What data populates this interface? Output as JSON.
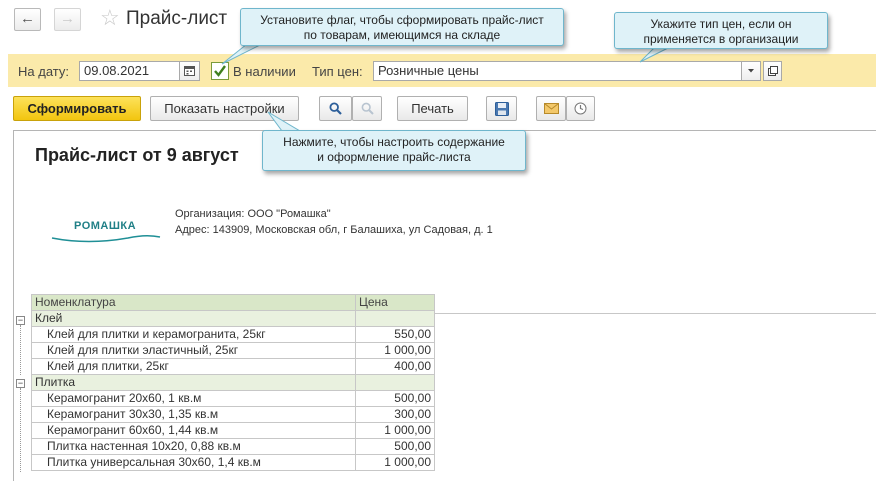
{
  "window": {
    "title": "Прайс-лист"
  },
  "icons": {
    "back": "arrow-left-icon",
    "forward": "arrow-right-icon",
    "favorite": "star-icon",
    "calendar": "calendar-icon",
    "checkbox": "checkmark-icon",
    "dropdown": "chevron-down-icon",
    "open": "open-form-icon",
    "search": "search-icon",
    "cancel_search": "cancel-search-icon",
    "save": "floppy-disk-icon",
    "email": "envelope-icon",
    "schedule": "clock-icon"
  },
  "params": {
    "date_label": "На дату:",
    "date_value": "09.08.2021",
    "in_stock_label": "В наличии",
    "in_stock_checked": true,
    "price_type_label": "Тип цен:",
    "price_type_value": "Розничные цены"
  },
  "toolbar": {
    "generate": "Сформировать",
    "show_settings": "Показать настройки",
    "print": "Печать"
  },
  "callouts": {
    "in_stock": [
      "Установите флаг, чтобы сформировать прайс-лист",
      "по товарам, имеющимся на складе"
    ],
    "price_type": [
      "Укажите тип цен, если он",
      "применяется в организации"
    ],
    "settings": [
      "Нажмите, чтобы настроить содержание",
      "и оформление прайс-листа"
    ]
  },
  "report": {
    "title": "Прайс-лист от 9 август",
    "logo_text": "РОМАШКА",
    "organization": "Организация: ООО \"Ромашка\"",
    "address": "Адрес: 143909, Московская обл, г Балашиха, ул Садовая, д. 1",
    "columns": [
      "Номенклатура",
      "Цена"
    ],
    "groups": [
      {
        "name": "Клей",
        "items": [
          {
            "name": "Клей для плитки и керамогранита, 25кг",
            "price": "550,00"
          },
          {
            "name": "Клей для плитки эластичный, 25кг",
            "price": "1 000,00"
          },
          {
            "name": "Клей для плитки, 25кг",
            "price": "400,00"
          }
        ]
      },
      {
        "name": "Плитка",
        "items": [
          {
            "name": "Керамогранит 20х60, 1 кв.м",
            "price": "500,00"
          },
          {
            "name": "Керамогранит 30х30, 1,35 кв.м",
            "price": "300,00"
          },
          {
            "name": "Керамогранит 60х60, 1,44 кв.м",
            "price": "1 000,00"
          },
          {
            "name": "Плитка настенная 10х20, 0,88 кв.м",
            "price": "500,00"
          },
          {
            "name": "Плитка универсальная 30х60, 1,4 кв.м",
            "price": "1 000,00"
          }
        ]
      }
    ]
  }
}
